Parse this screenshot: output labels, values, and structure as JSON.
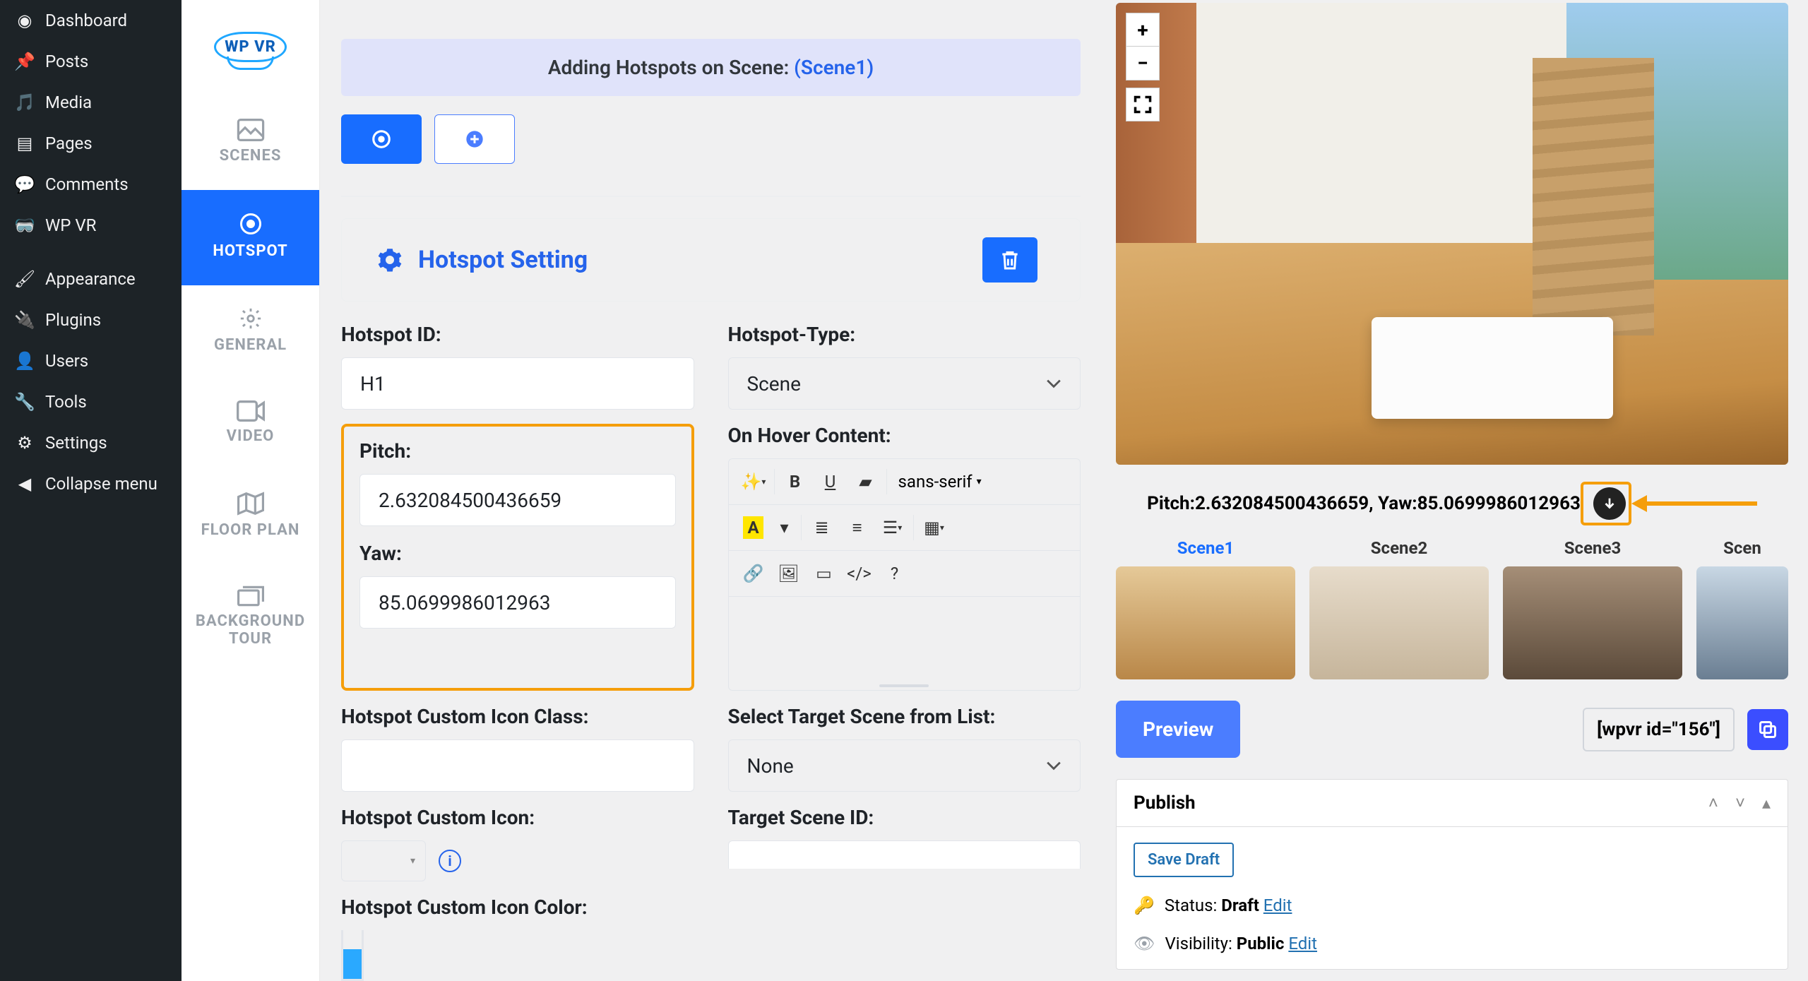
{
  "wp_menu": {
    "dashboard": "Dashboard",
    "posts": "Posts",
    "media": "Media",
    "pages": "Pages",
    "comments": "Comments",
    "wpvr": "WP VR",
    "appearance": "Appearance",
    "plugins": "Plugins",
    "users": "Users",
    "tools": "Tools",
    "settings": "Settings",
    "collapse": "Collapse menu"
  },
  "vtabs": {
    "scenes": "SCENES",
    "hotspot": "HOTSPOT",
    "general": "GENERAL",
    "video": "VIDEO",
    "floor": "FLOOR PLAN",
    "bgtour": "BACKGROUND TOUR"
  },
  "banner": {
    "prefix": "Adding Hotspots on Scene: ",
    "scene": "(Scene1)"
  },
  "card_title": "Hotspot Setting",
  "fields": {
    "hotspot_id_label": "Hotspot ID:",
    "hotspot_id_value": "H1",
    "hotspot_type_label": "Hotspot-Type:",
    "hotspot_type_value": "Scene",
    "pitch_label": "Pitch:",
    "pitch_value": "2.632084500436659",
    "yaw_label": "Yaw:",
    "yaw_value": "85.0699986012963",
    "hover_label": "On Hover Content:",
    "custom_class_label": "Hotspot Custom Icon Class:",
    "target_scene_label": "Select Target Scene from List:",
    "target_scene_value": "None",
    "custom_icon_label": "Hotspot Custom Icon:",
    "target_scene_id_label": "Target Scene ID:",
    "custom_color_label": "Hotspot Custom Icon Color:"
  },
  "editor": {
    "font": "sans-serif",
    "code": "</>"
  },
  "preview": {
    "zoom_in": "+",
    "zoom_out": "−",
    "readout_pitch_label": "Pitch: ",
    "readout_pitch": "2.632084500436659",
    "readout_yaw_label": ", Yaw: ",
    "readout_yaw": "85.0699986012963"
  },
  "scenes": [
    "Scene1",
    "Scene2",
    "Scene3",
    "Scen"
  ],
  "actions": {
    "preview": "Preview",
    "shortcode": "[wpvr id=\"156\"]"
  },
  "publish": {
    "title": "Publish",
    "save_draft": "Save Draft",
    "status_label": "Status: ",
    "status_value": "Draft",
    "visibility_label": "Visibility: ",
    "visibility_value": "Public",
    "edit": "Edit"
  }
}
